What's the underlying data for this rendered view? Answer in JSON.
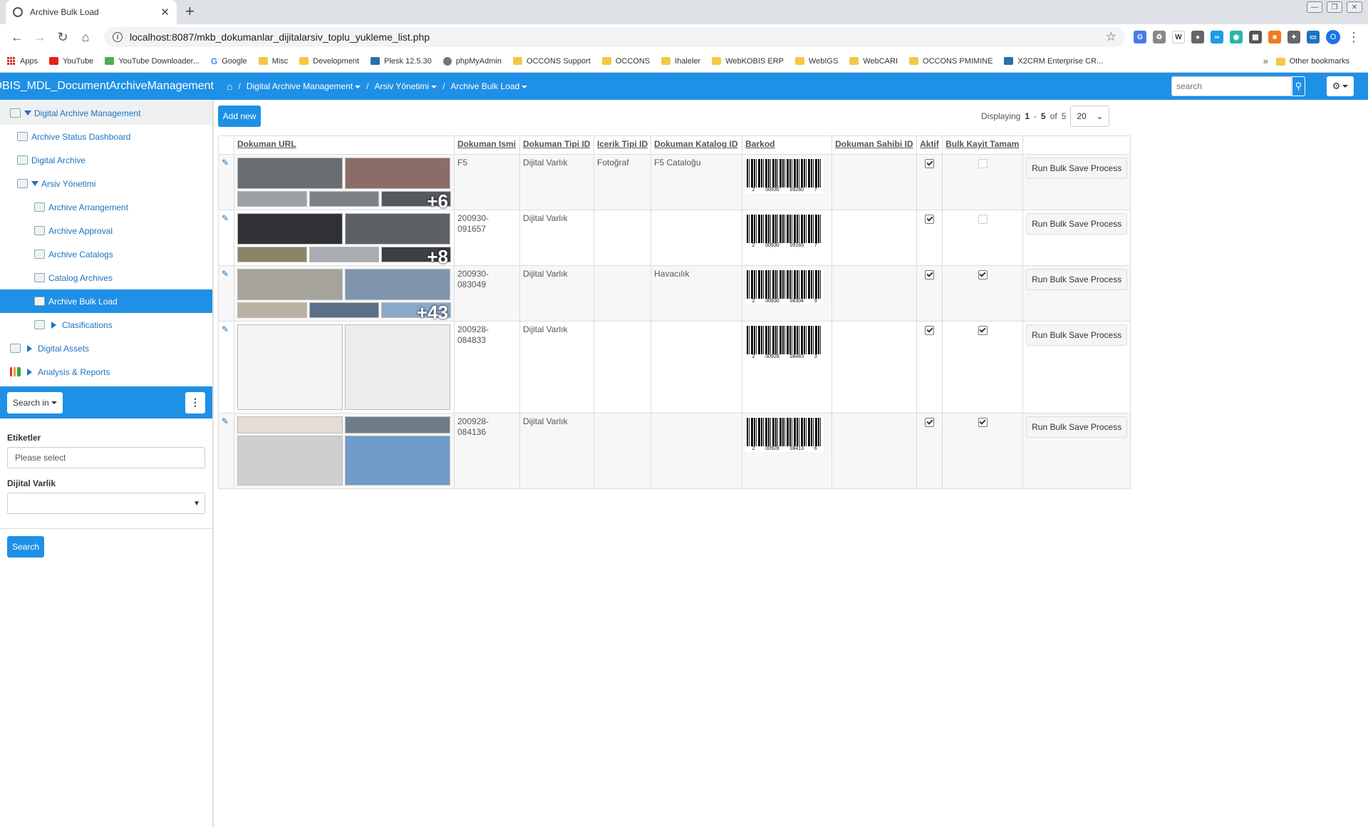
{
  "browser": {
    "tab_title": "Archive Bulk Load",
    "url": "localhost:8087/mkb_dokumanlar_dijitalarsiv_toplu_yukleme_list.php",
    "profile_initial": "O",
    "bookmarks": [
      "Apps",
      "YouTube",
      "YouTube Downloader...",
      "Google",
      "Misc",
      "Development",
      "Plesk 12.5.30",
      "phpMyAdmin",
      "OCCONS Support",
      "OCCONS",
      "Ihaleler",
      "WebKOBIS ERP",
      "WebIGS",
      "WebCARI",
      "OCCONS PMIMINE",
      "X2CRM Enterprise CR..."
    ],
    "other_bookmarks": "Other bookmarks",
    "overflow": "»"
  },
  "app": {
    "brand": "ebKOBIS_MDL_DocumentArchiveManagement",
    "breadcrumbs": [
      "Digital Archive Management",
      "Arsiv Yönetimi",
      "Archive Bulk Load"
    ],
    "search_placeholder": "search"
  },
  "sidebar": {
    "items": [
      {
        "label": "Digital Archive Management"
      },
      {
        "label": "Archive Status Dashboard"
      },
      {
        "label": "Digital Archive"
      },
      {
        "label": "Arsiv Yönetimi"
      },
      {
        "label": "Archive Arrangement"
      },
      {
        "label": "Archive Approval"
      },
      {
        "label": "Archive Catalogs"
      },
      {
        "label": "Catalog Archives"
      },
      {
        "label": "Archive Bulk Load"
      },
      {
        "label": "Clasifications"
      },
      {
        "label": "Digital Assets"
      },
      {
        "label": "Analysis & Reports"
      }
    ],
    "search_in": "Search in",
    "filter1_label": "Etiketler",
    "filter1_placeholder": "Please select",
    "filter2_label": "Dijital Varlik",
    "search_button": "Search"
  },
  "list": {
    "add_new": "Add new",
    "displaying_prefix": "Displaying",
    "range_from": "1",
    "range_sep": "-",
    "range_to": "5",
    "of_word": "of",
    "total": "5",
    "page_size": "20",
    "columns": [
      "Dokuman URL",
      "Dokuman Ismi",
      "Dokuman Tipi ID",
      "Icerik Tipi ID",
      "Dokuman Katalog ID",
      "Barkod",
      "Dokuman Sahibi ID",
      "Aktif",
      "Bulk Kayit Tamam"
    ],
    "run_label": "Run Bulk Save Process",
    "rows": [
      {
        "more": "+6",
        "name": "F5",
        "doctype": "Dijital Varlık",
        "content": "Fotoğraf",
        "catalog": "F5 Cataloğu",
        "bc_left": "00930",
        "bc_right": "09260",
        "bc_first": "2",
        "bc_last": "7",
        "aktif": true,
        "bulk": false
      },
      {
        "more": "+8",
        "name": "200930-091657",
        "doctype": "Dijital Varlık",
        "content": "",
        "catalog": "",
        "bc_left": "00930",
        "bc_right": "09165",
        "bc_first": "2",
        "bc_last": "7",
        "aktif": true,
        "bulk": false
      },
      {
        "more": "+43",
        "name": "200930-083049",
        "doctype": "Dijital Varlık",
        "content": "",
        "catalog": "Havacılık",
        "bc_left": "00930",
        "bc_right": "08304",
        "bc_first": "2",
        "bc_last": "9",
        "aktif": true,
        "bulk": true
      },
      {
        "more": "",
        "name": "200928-084833",
        "doctype": "Dijital Varlık",
        "content": "",
        "catalog": "",
        "bc_left": "00928",
        "bc_right": "08483",
        "bc_first": "2",
        "bc_last": "3",
        "aktif": true,
        "bulk": true
      },
      {
        "more": "",
        "name": "200928-084136",
        "doctype": "Dijital Varlık",
        "content": "",
        "catalog": "",
        "bc_left": "00928",
        "bc_right": "08413",
        "bc_first": "2",
        "bc_last": "6",
        "aktif": true,
        "bulk": true
      }
    ]
  },
  "colors": {
    "accent": "#1e90e6",
    "link": "#1e73be"
  }
}
